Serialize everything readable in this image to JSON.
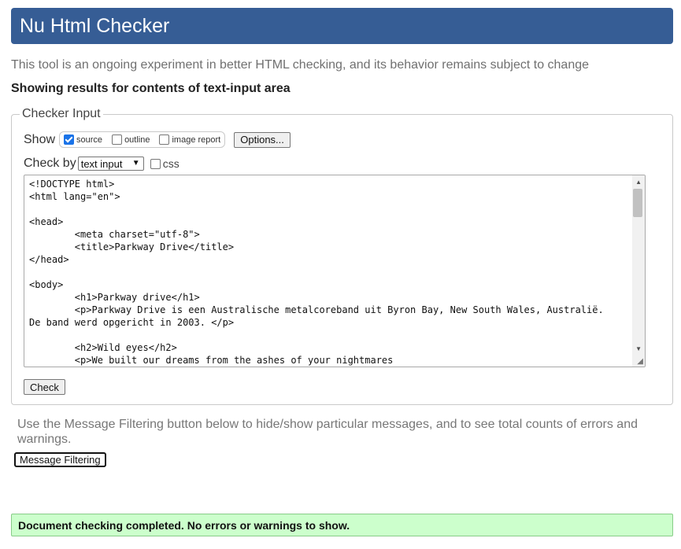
{
  "header": {
    "title": "Nu Html Checker"
  },
  "subtitle": "This tool is an ongoing experiment in better HTML checking, and its behavior remains subject to change",
  "showing": "Showing results for contents of text-input area",
  "checker": {
    "legend": "Checker Input",
    "show_label": "Show",
    "options": [
      {
        "label": "source",
        "checked": true
      },
      {
        "label": "outline",
        "checked": false
      },
      {
        "label": "image report",
        "checked": false
      }
    ],
    "options_button": "Options...",
    "check_by_label": "Check by",
    "check_by_value": "text input",
    "css_label": "css",
    "css_checked": false,
    "code_lines": [
      "<!DOCTYPE html>",
      "<html lang=\"en\">",
      "",
      "<head>",
      "        <meta charset=\"utf-8\">",
      "        <title>Parkway Drive</title>",
      "</head>",
      "",
      "<body>",
      "        <h1>Parkway drive</h1>",
      "        <p>Parkway Drive is een Australische metalcoreband uit Byron Bay, New South Wales, Australië.",
      "De band werd opgericht in 2003. </p>",
      "",
      "        <h2>Wild eyes</h2>",
      "        <p>We built our dreams from the ashes of your nightmares"
    ],
    "check_button": "Check"
  },
  "filter_info": "Use the Message Filtering button below to hide/show particular messages, and to see total counts of errors and warnings.",
  "filter_button": "Message Filtering",
  "result": "Document checking completed. No errors or warnings to show."
}
